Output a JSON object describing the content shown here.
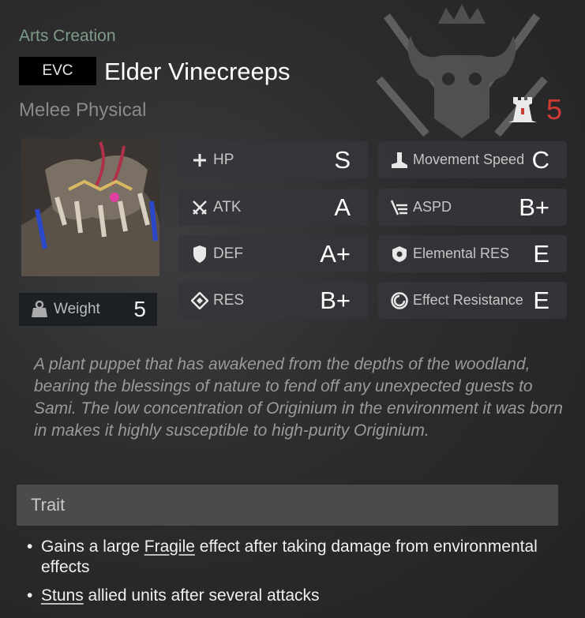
{
  "enemy": {
    "category": "Arts Creation",
    "code": "EVC",
    "name": "Elder Vinecreeps",
    "attack_type": "Melee Physical",
    "level": "5",
    "weight_label": "Weight",
    "weight_value": "5"
  },
  "stats": [
    {
      "label": "HP",
      "grade": "S",
      "icon": "plus-icon"
    },
    {
      "label": "ATK",
      "grade": "A",
      "icon": "crossed-swords-icon"
    },
    {
      "label": "DEF",
      "grade": "A+",
      "icon": "shield-icon"
    },
    {
      "label": "RES",
      "grade": "B+",
      "icon": "diamond-icon"
    },
    {
      "label": "Movement Speed",
      "grade": "C",
      "icon": "boot-icon"
    },
    {
      "label": "ASPD",
      "grade": "B+",
      "icon": "speed-lines-icon"
    },
    {
      "label": "Elemental RES",
      "grade": "E",
      "icon": "badge-shield-icon"
    },
    {
      "label": "Effect Resistance",
      "grade": "E",
      "icon": "spiral-icon"
    }
  ],
  "description": "A plant puppet that has awakened from the depths of the woodland, bearing the blessings of nature to fend off any unexpected guests to Sami. The low concentration of Originium in the environment it was born in makes it highly susceptible to high-purity Originium.",
  "trait": {
    "title": "Trait",
    "bullet": "•",
    "items": [
      {
        "pre": "Gains a large ",
        "keyword": "Fragile",
        "post": " effect after taking damage from environmental effects"
      },
      {
        "pre": "",
        "keyword": "Stuns",
        "post": " allied units after several attacks"
      }
    ]
  },
  "colors": {
    "level": "#d03a34",
    "category": "#7f9a86"
  }
}
